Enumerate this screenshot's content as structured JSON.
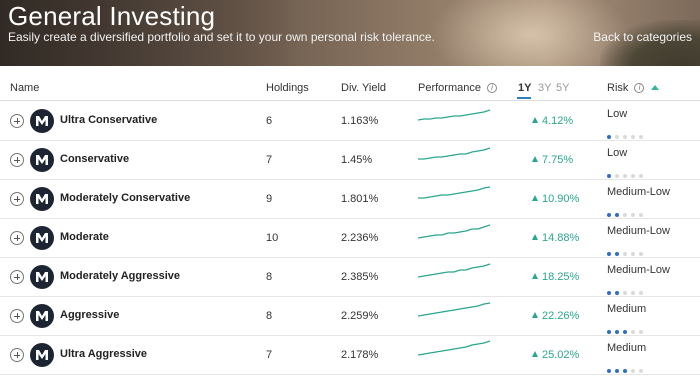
{
  "hero": {
    "title": "General Investing",
    "subtitle": "Easily create a diversified portfolio and set it to your own personal risk tolerance.",
    "back_link": "Back to categories"
  },
  "table": {
    "columns": {
      "name": "Name",
      "holdings": "Holdings",
      "yield": "Div. Yield",
      "performance": "Performance",
      "risk": "Risk"
    },
    "periods": [
      "1Y",
      "3Y",
      "5Y"
    ],
    "active_period": "1Y",
    "colors": {
      "accent": "#2a7fc0",
      "positive": "#2aa690",
      "risk_dot_on": "#2f6ec4",
      "risk_dot_off": "#d9d9d9",
      "logo_bg": "#1d2533"
    },
    "rows": [
      {
        "name": "Ultra Conservative",
        "holdings": "6",
        "yield": "1.163%",
        "performance": "4.12%",
        "risk": "Low",
        "risk_level": 1
      },
      {
        "name": "Conservative",
        "holdings": "7",
        "yield": "1.45%",
        "performance": "7.75%",
        "risk": "Low",
        "risk_level": 1
      },
      {
        "name": "Moderately Conservative",
        "holdings": "9",
        "yield": "1.801%",
        "performance": "10.90%",
        "risk": "Medium-Low",
        "risk_level": 2
      },
      {
        "name": "Moderate",
        "holdings": "10",
        "yield": "2.236%",
        "performance": "14.88%",
        "risk": "Medium-Low",
        "risk_level": 2
      },
      {
        "name": "Moderately Aggressive",
        "holdings": "8",
        "yield": "2.385%",
        "performance": "18.25%",
        "risk": "Medium-Low",
        "risk_level": 2
      },
      {
        "name": "Aggressive",
        "holdings": "8",
        "yield": "2.259%",
        "performance": "22.26%",
        "risk": "Medium",
        "risk_level": 3
      },
      {
        "name": "Ultra Aggressive",
        "holdings": "7",
        "yield": "2.178%",
        "performance": "25.02%",
        "risk": "Medium",
        "risk_level": 3
      }
    ]
  }
}
